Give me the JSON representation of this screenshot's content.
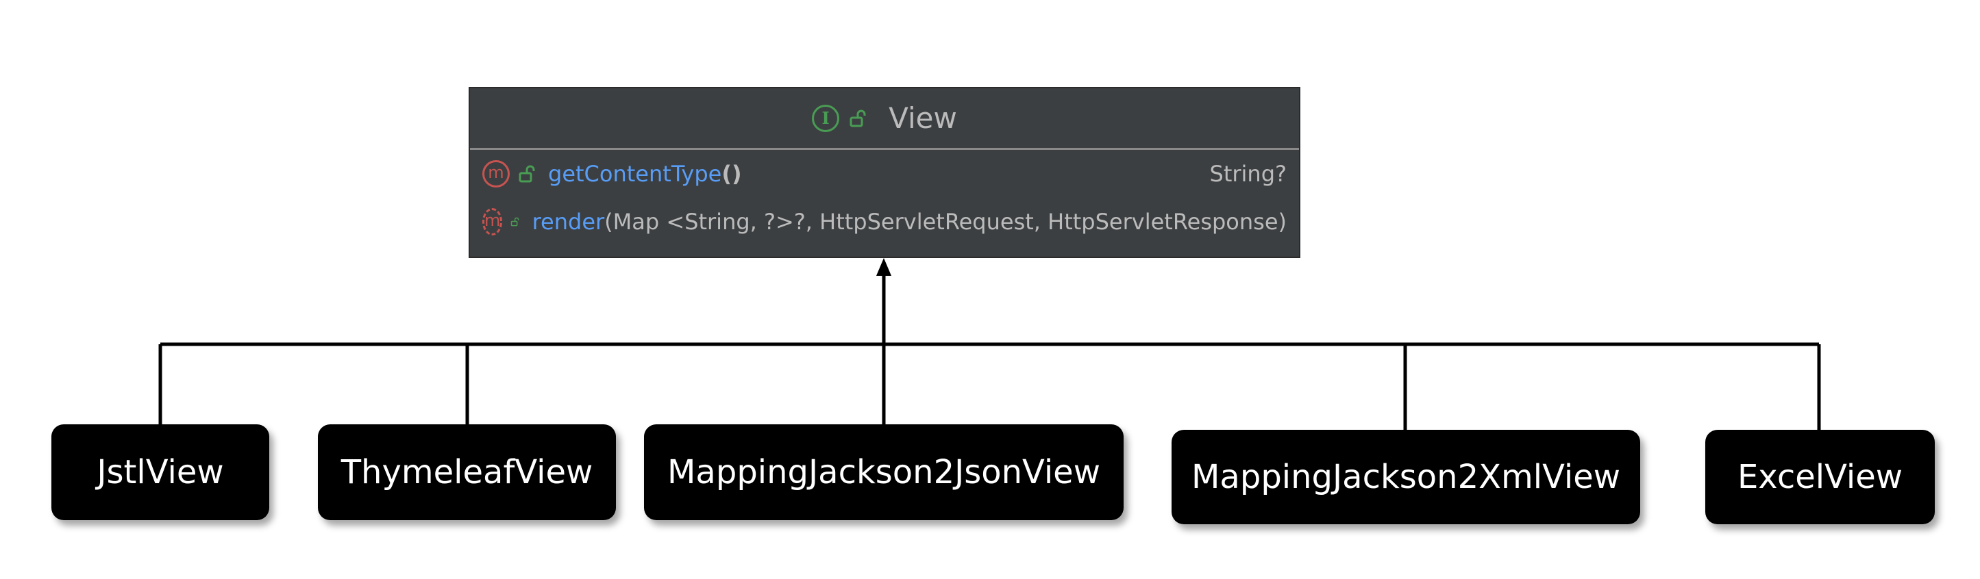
{
  "interface": {
    "kind_icon": "interface-icon",
    "kind_letter": "I",
    "title": "View",
    "members": [
      {
        "kind_icon": "method-icon",
        "kind_letter": "m",
        "abstract": false,
        "name": "getContentType",
        "params": "()",
        "return_type": "String?"
      },
      {
        "kind_icon": "abstract-method-icon",
        "kind_letter": "m",
        "abstract": true,
        "name": "render",
        "params": "(Map <String, ?>?, HttpServletRequest, HttpServletResponse)",
        "return_type": ""
      }
    ]
  },
  "implementations": [
    "JstlView",
    "ThymeleafView",
    "MappingJackson2JsonView",
    "MappingJackson2XmlView",
    "ExcelView"
  ],
  "colors": {
    "panel_bg": "#3c3f41",
    "method_name": "#589df6",
    "interface_badge": "#499c54",
    "method_badge": "#c75450",
    "node_bg": "#000000",
    "node_text": "#ffffff"
  }
}
